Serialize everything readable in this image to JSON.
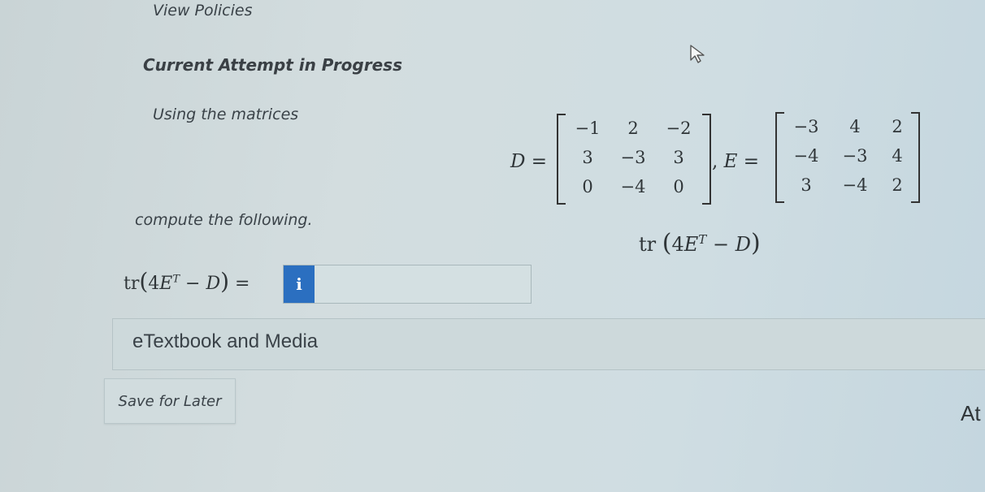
{
  "header": {
    "view_policies": "View Policies",
    "attempt_status": "Current Attempt in Progress"
  },
  "question": {
    "intro": "Using the matrices",
    "matrix_D": {
      "name": "D",
      "rows": [
        [
          "−1",
          "2",
          "−2"
        ],
        [
          "3",
          "−3",
          "3"
        ],
        [
          "0",
          "−4",
          "0"
        ]
      ]
    },
    "matrix_E": {
      "name": "E",
      "rows": [
        [
          "−3",
          "4",
          "2"
        ],
        [
          "−4",
          "−3",
          "4"
        ],
        [
          "3",
          "−4",
          "2"
        ]
      ]
    },
    "instruction": "compute the following.",
    "expression": {
      "func": "tr",
      "open": "(",
      "coef": "4",
      "var": "E",
      "sup": "T",
      "minus": "−",
      "var2": "D",
      "close": ")"
    }
  },
  "answer": {
    "label_eq": "=",
    "info_glyph": "i",
    "value": ""
  },
  "resources": {
    "etextbook": "eTextbook and Media"
  },
  "actions": {
    "save_for_later": "Save for Later",
    "attempt_cut": "At"
  },
  "icons": {
    "info": "info-icon",
    "cursor": "mouse-pointer-icon"
  },
  "colors": {
    "accent": "#2b6fc0"
  }
}
